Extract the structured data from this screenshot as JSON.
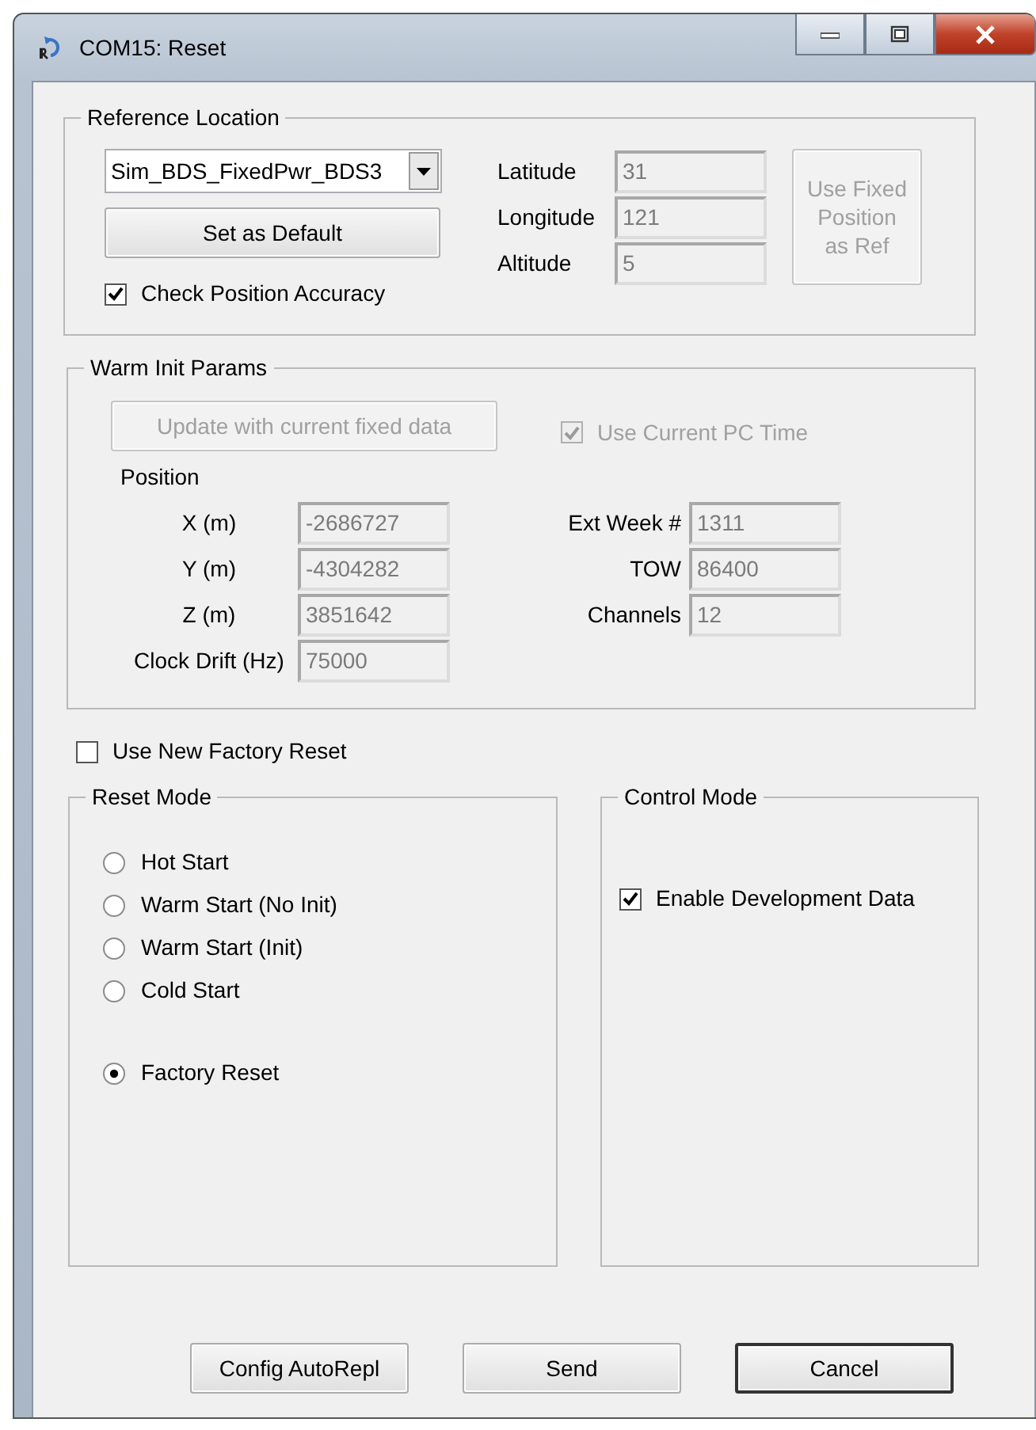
{
  "window": {
    "title": "COM15: Reset"
  },
  "reference_location": {
    "title": "Reference Location",
    "dropdown": {
      "value": "Sim_BDS_FixedPwr_BDS3"
    },
    "set_default_button": {
      "label": "Set as Default",
      "disabled": false
    },
    "check_position_accuracy": {
      "label": "Check Position Accuracy",
      "checked": true,
      "disabled": false
    },
    "fields": [
      {
        "label": "Latitude",
        "value": "31",
        "disabled": true
      },
      {
        "label": "Longitude",
        "value": "121",
        "disabled": true
      },
      {
        "label": "Altitude",
        "value": "5",
        "disabled": true
      }
    ],
    "use_fixed_button": {
      "label": "Use Fixed Position as Ref",
      "disabled": true
    }
  },
  "warm_init_params": {
    "title": "Warm Init Params",
    "update_button": {
      "label": "Update with current fixed data",
      "disabled": true
    },
    "use_current_pc_time": {
      "label": "Use Current PC Time",
      "checked": true,
      "disabled": true
    },
    "position_label": "Position",
    "position_fields": [
      {
        "label": "X (m)",
        "value": "-2686727",
        "disabled": true
      },
      {
        "label": "Y (m)",
        "value": "-4304282",
        "disabled": true
      },
      {
        "label": "Z (m)",
        "value": "3851642",
        "disabled": true
      },
      {
        "label": "Clock Drift (Hz)",
        "value": "75000",
        "disabled": true
      }
    ],
    "time_fields": [
      {
        "label": "Ext Week #",
        "value": "1311",
        "disabled": true
      },
      {
        "label": "TOW",
        "value": "86400",
        "disabled": true
      },
      {
        "label": "Channels",
        "value": "12",
        "disabled": true
      }
    ]
  },
  "use_new_factory_reset": {
    "label": "Use New Factory Reset",
    "checked": false,
    "disabled": false
  },
  "reset_mode": {
    "title": "Reset Mode",
    "options": [
      {
        "label": "Hot Start",
        "selected": false
      },
      {
        "label": "Warm Start (No Init)",
        "selected": false
      },
      {
        "label": "Warm Start (Init)",
        "selected": false
      },
      {
        "label": "Cold Start",
        "selected": false
      },
      {
        "label": "Factory Reset",
        "selected": true
      }
    ]
  },
  "control_mode": {
    "title": "Control Mode",
    "options": [
      {
        "label": "Enable Development Data",
        "checked": true,
        "disabled": false
      }
    ]
  },
  "buttons": [
    {
      "label": "Config AutoRepl",
      "default": false
    },
    {
      "label": "Send",
      "default": false
    },
    {
      "label": "Cancel",
      "default": true
    }
  ]
}
